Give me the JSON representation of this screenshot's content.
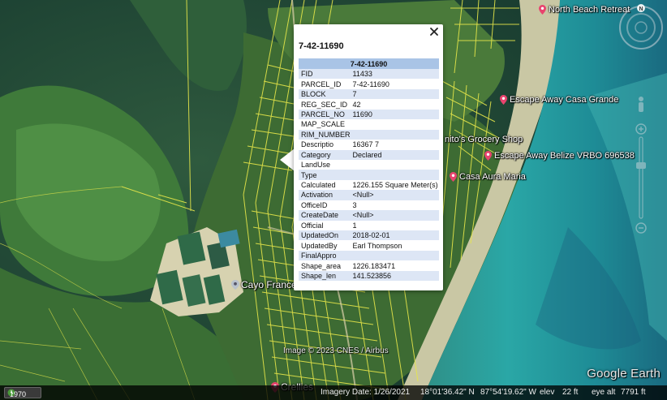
{
  "popup": {
    "title": "7-42-11690",
    "table_header": "7-42-11690",
    "rows": [
      {
        "key": "FID",
        "value": "11433"
      },
      {
        "key": "PARCEL_ID",
        "value": "7-42-11690"
      },
      {
        "key": "BLOCK",
        "value": "7"
      },
      {
        "key": "REG_SEC_ID",
        "value": "42"
      },
      {
        "key": "PARCEL_NO",
        "value": "11690"
      },
      {
        "key": "MAP_SCALE",
        "value": ""
      },
      {
        "key": "RIM_NUMBER",
        "value": ""
      },
      {
        "key": "Descriptio",
        "value": "16367 7"
      },
      {
        "key": "Category",
        "value": "Declared"
      },
      {
        "key": "LandUse",
        "value": ""
      },
      {
        "key": "Type",
        "value": ""
      },
      {
        "key": "Calculated",
        "value": "1226.155 Square Meter(s)"
      },
      {
        "key": "Activation",
        "value": "<Null>"
      },
      {
        "key": "OfficeID",
        "value": "3"
      },
      {
        "key": "CreateDate",
        "value": "<Null>"
      },
      {
        "key": "Official",
        "value": "1"
      },
      {
        "key": "UpdatedOn",
        "value": "2018-02-01"
      },
      {
        "key": "UpdatedBy",
        "value": "Earl Thompson"
      },
      {
        "key": "FinalAppro",
        "value": ""
      },
      {
        "key": "Shape_area",
        "value": "1226.183471"
      },
      {
        "key": "Shape_len",
        "value": "141.523856"
      }
    ]
  },
  "places": {
    "north_beach": "North Beach Retreat",
    "casa_grande": "Escape Away Casa Grande",
    "grocery": "nito's Grocery Shop",
    "vrbo": "Escape Away Belize VRBO 696538",
    "casa_aura": "Casa Aura Maria",
    "cayo": "Cayo Frances",
    "crellies": "Crellies"
  },
  "attribution": "Image © 2023 CNES / Airbus",
  "brand": "Google Earth",
  "navigation": {
    "north_label": "N"
  },
  "status": {
    "history_year": "1970",
    "imagery_date": "Imagery Date: 1/26/2021",
    "lat": "18°01'36.42\" N",
    "lon": "87°54'19.62\" W",
    "elev_label": "elev",
    "elev_value": "22 ft",
    "eye_alt_label": "eye alt",
    "eye_alt_value": "7791 ft"
  },
  "colors": {
    "parcel_lines": "#e6e64a",
    "table_header": "#a9c4e6",
    "row_alt": "#dde6f5",
    "pin": "#e8446e"
  }
}
